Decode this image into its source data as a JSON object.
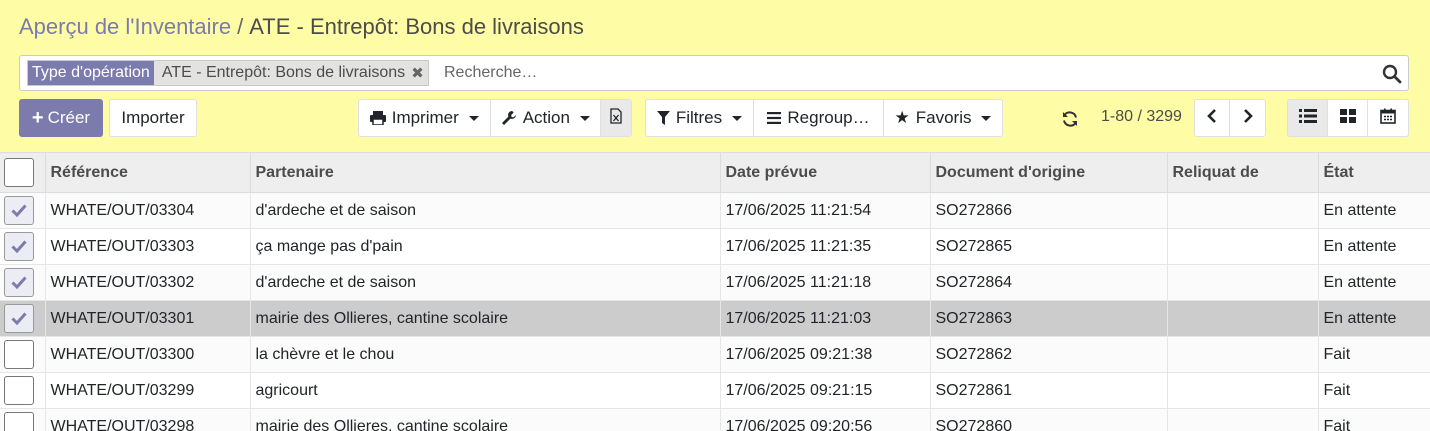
{
  "breadcrumb": {
    "parent": "Aperçu de l'Inventaire",
    "separator": "/",
    "current": "ATE - Entrepôt: Bons de livraisons"
  },
  "search": {
    "facet_label": "Type d'opération",
    "facet_value": "ATE - Entrepôt: Bons de livraisons",
    "placeholder": "Recherche…"
  },
  "toolbar": {
    "create_label": "Créer",
    "import_label": "Importer",
    "print_label": "Imprimer",
    "action_label": "Action",
    "filters_label": "Filtres",
    "groupby_label": "Regroup…",
    "favorites_label": "Favoris"
  },
  "pager": {
    "value": "1-80 / 3299"
  },
  "colors": {
    "control_panel_bg": "#fefca4",
    "accent": "#7c7bad"
  },
  "table": {
    "columns": [
      "Référence",
      "Partenaire",
      "Date prévue",
      "Document d'origine",
      "Reliquat de",
      "État"
    ],
    "rows": [
      {
        "checked": true,
        "ref": "WHATE/OUT/03304",
        "partner": "d'ardeche et de saison",
        "date": "17/06/2025 11:21:54",
        "origin": "SO272866",
        "backorder": "",
        "state": "En attente"
      },
      {
        "checked": true,
        "ref": "WHATE/OUT/03303",
        "partner": "ça mange pas d'pain",
        "date": "17/06/2025 11:21:35",
        "origin": "SO272865",
        "backorder": "",
        "state": "En attente"
      },
      {
        "checked": true,
        "ref": "WHATE/OUT/03302",
        "partner": "d'ardeche et de saison",
        "date": "17/06/2025 11:21:18",
        "origin": "SO272864",
        "backorder": "",
        "state": "En attente"
      },
      {
        "checked": true,
        "ref": "WHATE/OUT/03301",
        "partner": "mairie des Ollieres, cantine scolaire",
        "date": "17/06/2025 11:21:03",
        "origin": "SO272863",
        "backorder": "",
        "state": "En attente"
      },
      {
        "checked": false,
        "ref": "WHATE/OUT/03300",
        "partner": "la chèvre et le chou",
        "date": "17/06/2025 09:21:38",
        "origin": "SO272862",
        "backorder": "",
        "state": "Fait"
      },
      {
        "checked": false,
        "ref": "WHATE/OUT/03299",
        "partner": "agricourt",
        "date": "17/06/2025 09:21:15",
        "origin": "SO272861",
        "backorder": "",
        "state": "Fait"
      },
      {
        "checked": false,
        "ref": "WHATE/OUT/03298",
        "partner": "mairie des Ollieres, cantine scolaire",
        "date": "17/06/2025 09:20:56",
        "origin": "SO272860",
        "backorder": "",
        "state": "Fait"
      }
    ]
  }
}
